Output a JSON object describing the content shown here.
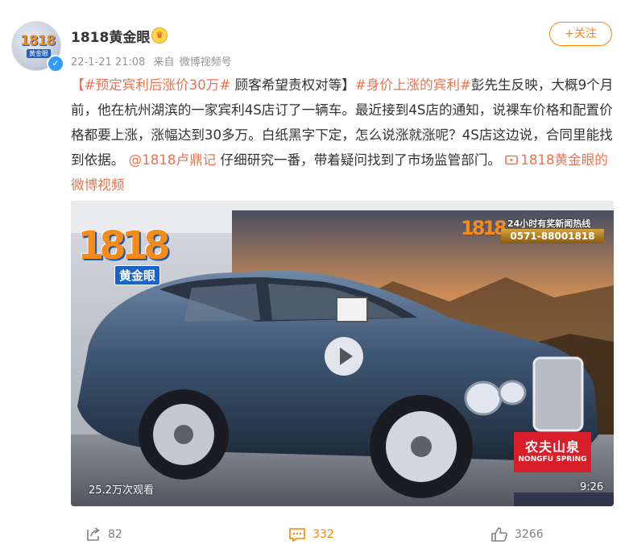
{
  "author": {
    "name": "1818黄金眼",
    "avatar_text": "1818",
    "avatar_tag": "黄金眼"
  },
  "meta": {
    "time": "22-1-21 21:08",
    "source_prefix": "来自",
    "source": "微博视频号"
  },
  "follow_label": "+关注",
  "post": {
    "tag1": "【#预定宾利后涨价30万#",
    "text1": "顾客希望责权对等】",
    "tag2": "#身价上涨的宾利#",
    "text2": "彭先生反映，大概9个月前，他在杭州湖滨的一家宾利4S店订了一辆车。最近接到4S店的通知，说裸车价格和配置价格都要上涨，涨幅达到30多万。白纸黑字下定，怎么说涨就涨呢？4S店这边说，合同里能找到依据。",
    "mention": "@1818卢鼎记",
    "text3": "仔细研究一番，带着疑问找到了市场监管部门。",
    "video_link": "1818黄金眼的微博视频"
  },
  "video": {
    "logo_num": "1818",
    "logo_tag": "黄金眼",
    "hotline_title": "24小时有奖新闻热线",
    "hotline_number": "0571-88001818",
    "sponsor_cn": "农夫山泉",
    "sponsor_en": "NONGFU SPRING",
    "views": "25.2万次观看",
    "duration": "9:26"
  },
  "actions": {
    "repost": "82",
    "comment": "332",
    "like": "3266"
  },
  "colors": {
    "accent": "#ff8200",
    "link": "#eb7350",
    "meta": "#939393"
  }
}
